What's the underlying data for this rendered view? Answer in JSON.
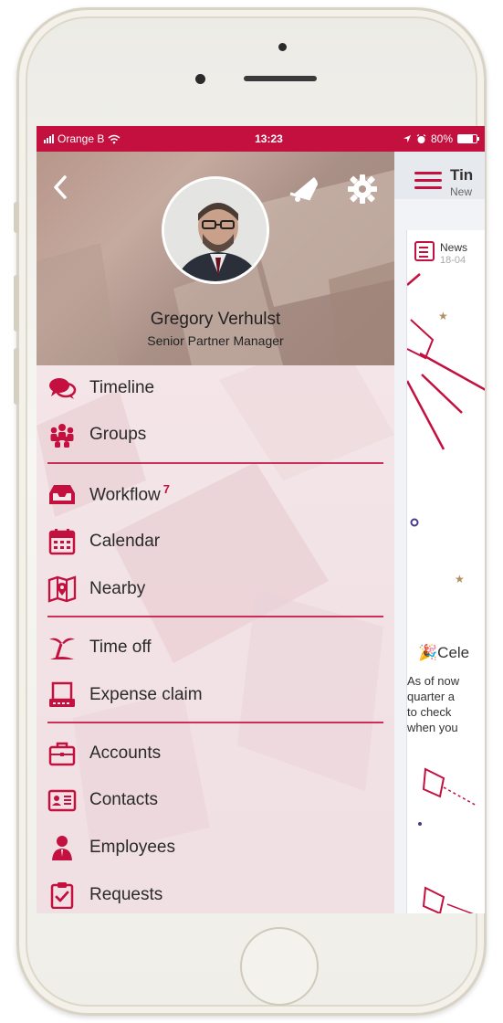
{
  "status_bar": {
    "carrier": "Orange B",
    "time": "13:23",
    "battery": "80%",
    "battery_level": 0.8
  },
  "drawer": {
    "profile": {
      "name": "Gregory Verhulst",
      "role": "Senior Partner Manager"
    },
    "icons": {
      "back": "chevron-left-icon",
      "notifications": "bell-icon",
      "settings": "gear-icon"
    },
    "menu_items": [
      {
        "label": "Timeline",
        "icon": "chat-bubbles-icon"
      },
      {
        "label": "Groups",
        "icon": "group-icon"
      },
      {
        "label": "Workflow",
        "icon": "inbox-tray-icon",
        "badge": "7"
      },
      {
        "label": "Calendar",
        "icon": "calendar-icon"
      },
      {
        "label": "Nearby",
        "icon": "map-pin-icon"
      },
      {
        "label": "Time off",
        "icon": "palm-tree-icon"
      },
      {
        "label": "Expense claim",
        "icon": "receipt-icon"
      },
      {
        "label": "Accounts",
        "icon": "briefcase-icon"
      },
      {
        "label": "Contacts",
        "icon": "contact-card-icon"
      },
      {
        "label": "Employees",
        "icon": "person-icon"
      },
      {
        "label": "Requests",
        "icon": "clipboard-check-icon"
      }
    ]
  },
  "main": {
    "title": "Tin",
    "subtitle": "New",
    "news_label": "News",
    "news_date": "18-04",
    "celebration_title": "Cele",
    "celebration_text": [
      "As of now",
      "quarter a",
      "to check",
      "when you"
    ]
  },
  "colors": {
    "accent": "#c3103f",
    "drawer_bg": "#f3e4e7",
    "text": "#2a2a2a"
  }
}
